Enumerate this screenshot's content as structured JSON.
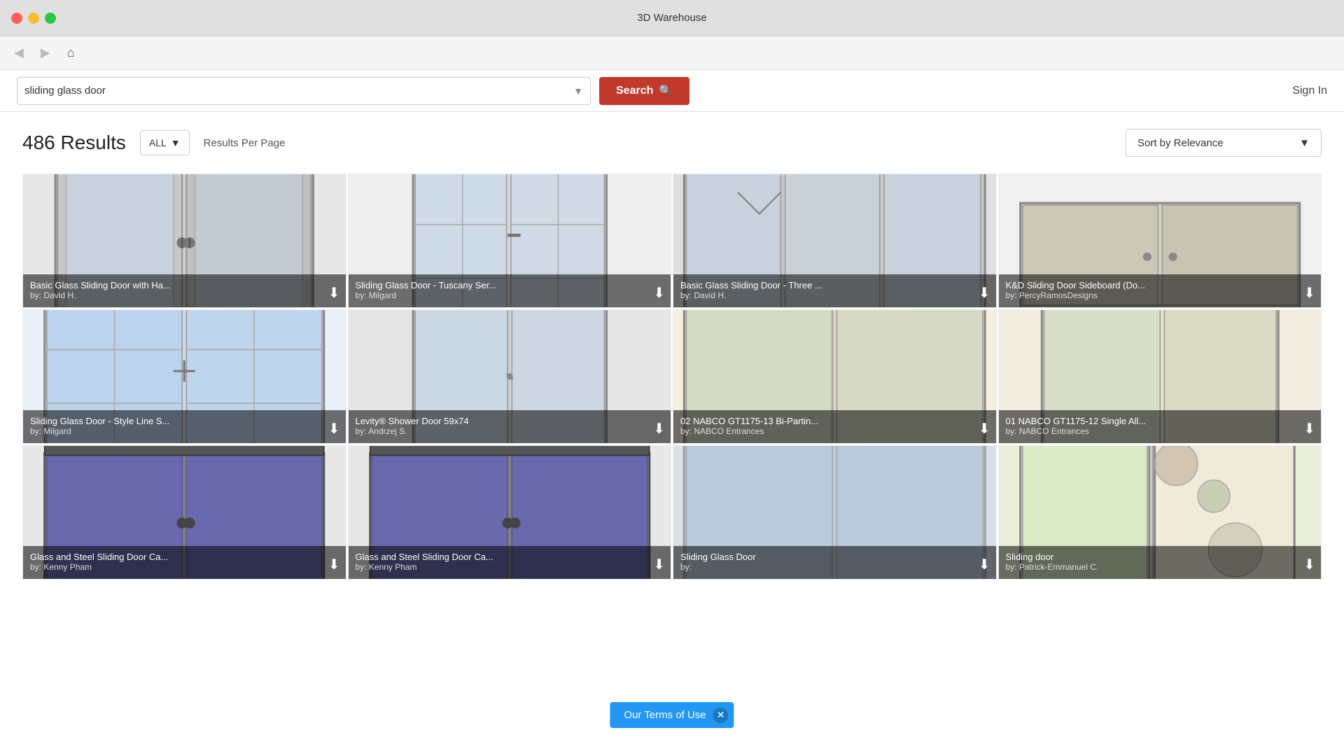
{
  "window": {
    "title": "3D Warehouse"
  },
  "nav": {
    "back_label": "◀",
    "forward_label": "▶",
    "home_label": "⌂"
  },
  "search": {
    "query": "sliding glass door",
    "placeholder": "sliding glass door",
    "button_label": "Search",
    "sign_in_label": "Sign In"
  },
  "results": {
    "count": "486 Results",
    "filter_label": "ALL",
    "results_per_page_label": "Results Per Page",
    "sort_label": "Sort by Relevance"
  },
  "items": [
    {
      "id": 1,
      "title": "Basic Glass Sliding Door with Ha...",
      "author": "by: David H.",
      "bg": "#e8e8e8",
      "type": "double_door"
    },
    {
      "id": 2,
      "title": "Sliding Glass Door - Tuscany Ser...",
      "author": "by: Milgard",
      "bg": "#efefef",
      "type": "grid_door"
    },
    {
      "id": 3,
      "title": "Basic Glass Sliding Door - Three ...",
      "author": "by: David H.",
      "bg": "#e0e0e0",
      "type": "triple_door"
    },
    {
      "id": 4,
      "title": "K&D Sliding Door Sideboard (Do...",
      "author": "by: PercyRamosDesigns",
      "bg": "#f0f0f0",
      "type": "sideboard"
    },
    {
      "id": 5,
      "title": "Sliding Glass Door - Style Line S...",
      "author": "by: Milgard",
      "bg": "#eaf0f8",
      "type": "grid_double"
    },
    {
      "id": 6,
      "title": "Levity® Shower Door 59x74",
      "author": "by: Andrzej S.",
      "bg": "#e5e5e5",
      "type": "shower"
    },
    {
      "id": 7,
      "title": "02 NABCO GT1175-13 Bi-Partin...",
      "author": "by: NABCO Entrances",
      "bg": "#f5efe0",
      "type": "commercial_bi"
    },
    {
      "id": 8,
      "title": "01 NABCO GT1175-12 Single All...",
      "author": "by: NABCO Entrances",
      "bg": "#f0ece0",
      "type": "commercial_single"
    },
    {
      "id": 9,
      "title": "Glass and Steel Sliding Door Ca...",
      "author": "by: Kenny Pham",
      "bg": "#e8e8e8",
      "type": "cabinet"
    },
    {
      "id": 10,
      "title": "Glass and Steel Sliding Door Ca...",
      "author": "by: Kenny Pham",
      "bg": "#e8e8e8",
      "type": "cabinet"
    },
    {
      "id": 11,
      "title": "Sliding Glass Door",
      "author": "by:",
      "bg": "#d8e0e8",
      "type": "simple"
    },
    {
      "id": 12,
      "title": "Sliding door",
      "author": "by: Patrick-Emmanuel C.",
      "bg": "#e8eed8",
      "type": "decorative"
    }
  ],
  "terms": {
    "label": "Our Terms of Use"
  }
}
